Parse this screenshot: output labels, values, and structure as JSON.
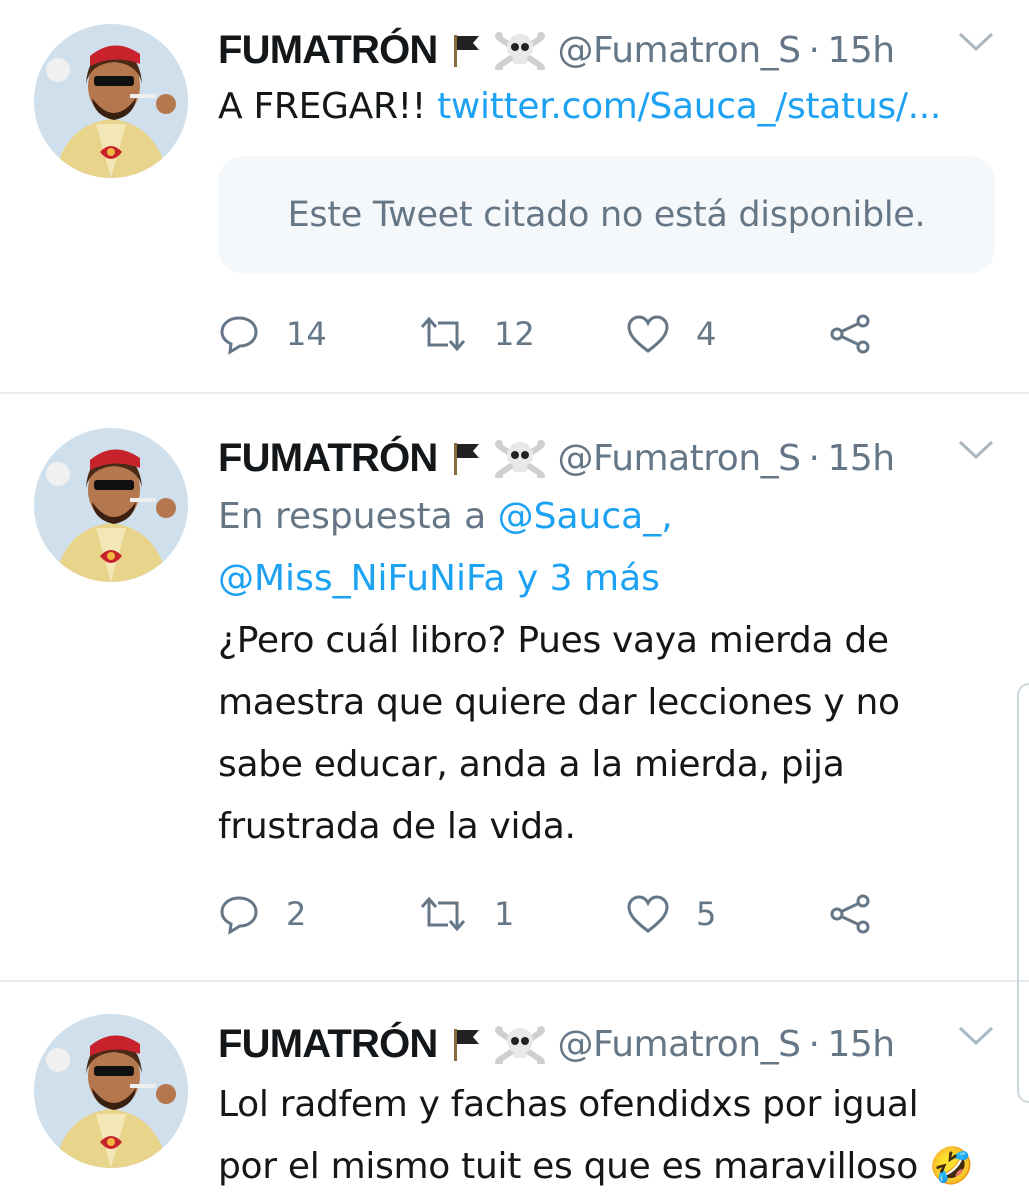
{
  "tweets": [
    {
      "name": "FUMATRÓN",
      "handle": "@Fumatron_S",
      "separator": "·",
      "time": "15h",
      "text_prefix": "A FREGAR!! ",
      "text_link": "twitter.com/Sauca_/status/...",
      "quote_text": "Este Tweet citado no está disponible.",
      "replies": "14",
      "retweets": "12",
      "likes": "4"
    },
    {
      "name": "FUMATRÓN",
      "handle": "@Fumatron_S",
      "separator": "·",
      "time": "15h",
      "reply_prefix": "En respuesta a ",
      "reply_mention_1": "@Sauca_,",
      "reply_mention_2": "@Miss_NiFuNiFa y 3 más",
      "text": "¿Pero cuál libro? Pues vaya mierda de maestra que quiere dar lecciones y no sabe educar, anda a la mierda, pija frustrada de la vida.",
      "replies": "2",
      "retweets": "1",
      "likes": "5"
    },
    {
      "name": "FUMATRÓN",
      "handle": "@Fumatron_S",
      "separator": "·",
      "time": "15h",
      "text": "Lol radfem y fachas ofendidxs por igual por el mismo tuit es que es maravilloso 🤣"
    }
  ],
  "icons": {
    "name_emojis": [
      "black-flag-icon",
      "skull-crossbones-icon"
    ],
    "actions": [
      "reply-icon",
      "retweet-icon",
      "like-icon",
      "share-icon"
    ],
    "menu": "chevron-down-icon"
  },
  "colors": {
    "text": "#14171a",
    "secondary": "#657786",
    "link": "#1da1f2",
    "divider": "#e6ecf0",
    "quote_bg": "#f5f8fa"
  }
}
